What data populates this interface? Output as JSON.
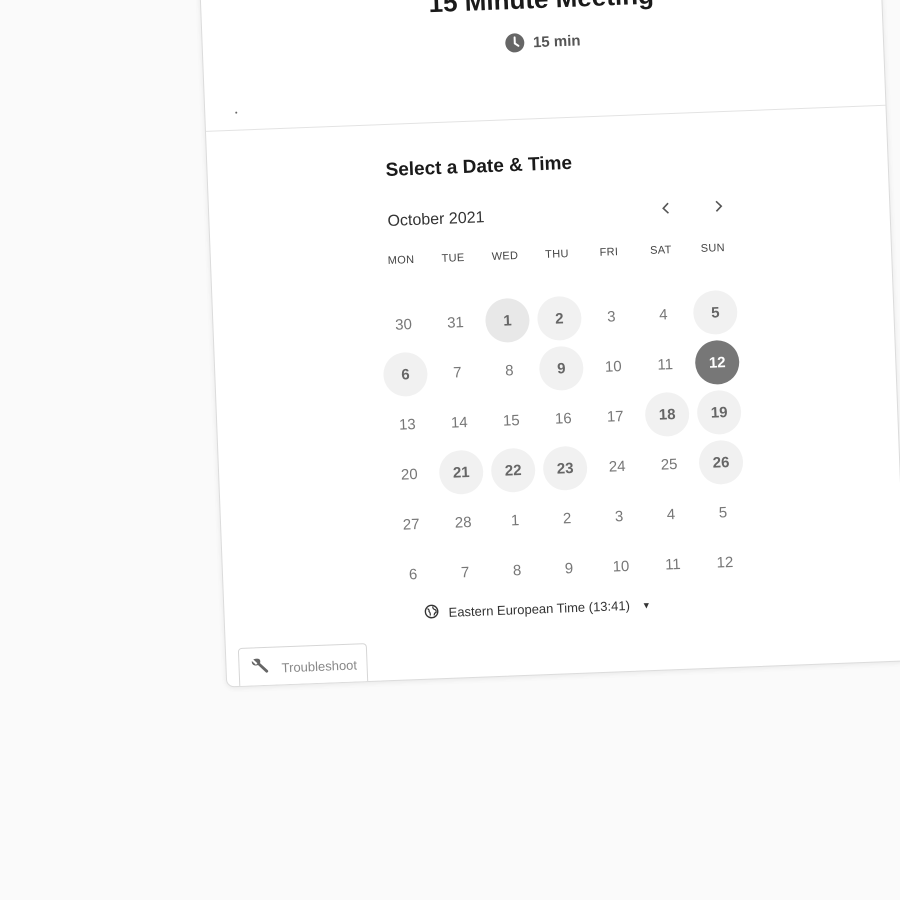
{
  "event": {
    "title": "15 Minute Meeting",
    "duration": "15 min"
  },
  "calendar": {
    "heading": "Select a Date & Time",
    "month_label": "October 2021",
    "prev_icon": "chevron-left-icon",
    "next_icon": "chevron-right-icon",
    "weekdays": [
      "MON",
      "TUE",
      "WED",
      "THU",
      "FRI",
      "SAT",
      "SUN"
    ],
    "weeks": [
      [
        "30",
        "31",
        "1",
        "2",
        "3",
        "4",
        "5"
      ],
      [
        "6",
        "7",
        "8",
        "9",
        "10",
        "11",
        "12"
      ],
      [
        "13",
        "14",
        "15",
        "16",
        "17",
        "18",
        "19"
      ],
      [
        "20",
        "21",
        "22",
        "23",
        "24",
        "25",
        "26"
      ],
      [
        "27",
        "28",
        "1",
        "2",
        "3",
        "4",
        "5"
      ],
      [
        "6",
        "7",
        "8",
        "9",
        "10",
        "11",
        "12"
      ]
    ]
  },
  "timezone": {
    "label": "Eastern European Time (13:41)",
    "icon": "globe-icon"
  },
  "troubleshoot": {
    "label": "Troubleshoot",
    "icon": "wrench-icon"
  },
  "colors": {
    "selected": "#777777",
    "available": "#f1f1f1",
    "background": "#fafafa"
  }
}
